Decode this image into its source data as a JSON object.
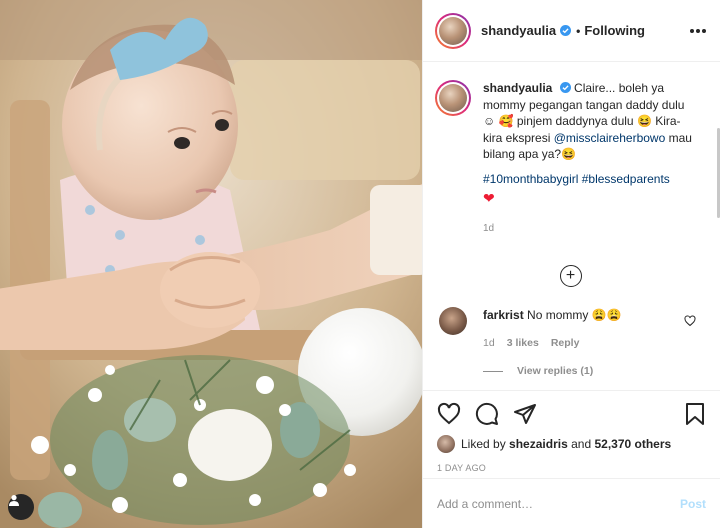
{
  "header": {
    "username": "shandyaulia",
    "separator": "•",
    "follow_status": "Following"
  },
  "caption": {
    "username": "shandyaulia",
    "text_1": "Claire... boleh ya mommy pegangan tangan daddy dulu ☺ 🥰 pinjem daddynya dulu 😆 Kira-kira ekspresi",
    "mention": "@missclaireherbowo",
    "text_2": "mau bilang apa ya?😆",
    "hashtags": "#10monthbabygirl #blessedparents",
    "heart": "❤",
    "time": "1d"
  },
  "load_more_symbol": "+",
  "comment": {
    "username": "farkrist",
    "text": "No mommy 😩😩",
    "time": "1d",
    "likes": "3 likes",
    "reply": "Reply",
    "view_replies": "View replies (1)"
  },
  "likes": {
    "prefix": "Liked by",
    "user": "shezaidris",
    "and": "and",
    "others": "52,370 others"
  },
  "posted_time": "1 DAY AGO",
  "add_comment": {
    "placeholder": "Add a comment…",
    "post_label": "Post"
  },
  "colors": {
    "link": "#00376b",
    "verified": "#3897f0",
    "post_disabled": "#b2dffc",
    "story_ring": "#dd2a7b"
  },
  "icons": [
    "verified-icon",
    "more-options-icon",
    "add-circle-icon",
    "heart-outline-icon",
    "comment-icon",
    "share-icon",
    "bookmark-icon",
    "tagged-user-icon"
  ]
}
